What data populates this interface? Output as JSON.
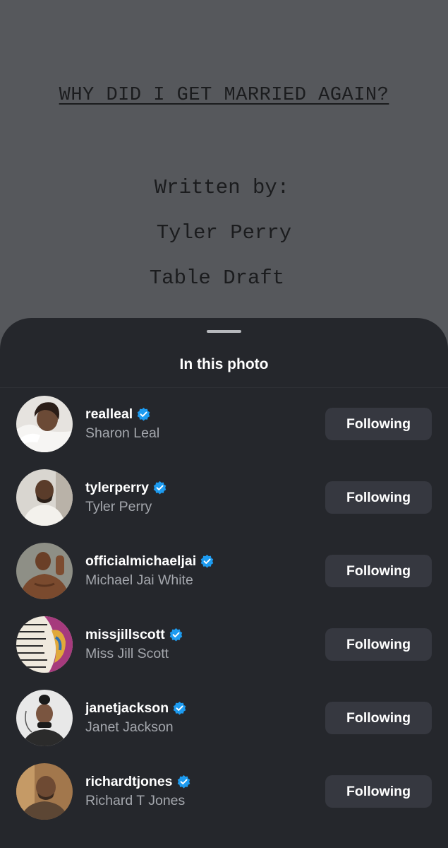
{
  "background": {
    "title": "WHY DID I GET MARRIED AGAIN?",
    "written_by": "Written by:",
    "author": "Tyler Perry",
    "draft": "Table Draft"
  },
  "sheet": {
    "title": "In this photo",
    "people": [
      {
        "username": "realleal",
        "full_name": "Sharon Leal",
        "verified": true,
        "button_label": "Following"
      },
      {
        "username": "tylerperry",
        "full_name": "Tyler Perry",
        "verified": true,
        "button_label": "Following"
      },
      {
        "username": "officialmichaeljai",
        "full_name": "Michael Jai White",
        "verified": true,
        "button_label": "Following"
      },
      {
        "username": "missjillscott",
        "full_name": "Miss Jill Scott",
        "verified": true,
        "button_label": "Following"
      },
      {
        "username": "janetjackson",
        "full_name": "Janet Jackson",
        "verified": true,
        "button_label": "Following"
      },
      {
        "username": "richardtjones",
        "full_name": "Richard T Jones",
        "verified": true,
        "button_label": "Following"
      }
    ]
  },
  "colors": {
    "sheet_bg": "#25272c",
    "button_bg": "#363840",
    "verified_blue": "#1d9bf0",
    "secondary_text": "#a4a7ad"
  },
  "icons": [
    "verified-badge-icon",
    "grabber-handle"
  ]
}
